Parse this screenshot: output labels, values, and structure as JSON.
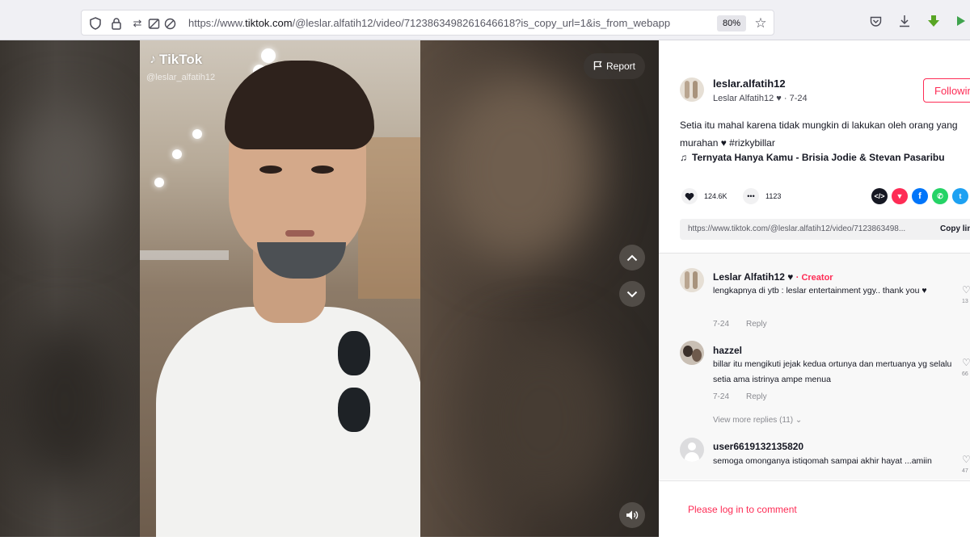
{
  "browser": {
    "url_prefix": "https://www.",
    "url_domain": "tiktok.com",
    "url_path": "/@leslar.alfatih12/video/7123863498261646618?is_copy_url=1&is_from_webapp",
    "zoom": "80%"
  },
  "video": {
    "logo_text": "TikTok",
    "watermark_user": "@leslar_alfatih12",
    "report_label": "Report"
  },
  "post": {
    "username": "leslar.alfatih12",
    "display_name": "Leslar Alfatih12 ♥",
    "date": "· 7-24",
    "follow_label": "Following",
    "caption_line1": "Setia itu mahal karena tidak mungkin di lakukan oleh orang yang",
    "caption_line2": "murahan ♥ #rizkybillar",
    "music": "Ternyata Hanya Kamu - Brisia Jodie & Stevan Pasaribu",
    "likes": "124.6K",
    "comments_count": "1123",
    "share_link": "https://www.tiktok.com/@leslar.alfatih12/video/7123863498...",
    "copy_link_label": "Copy link"
  },
  "comments": [
    {
      "name": "Leslar Alfatih12 ♥",
      "creator_label": "· Creator",
      "text": "lengkapnya di ytb : leslar entertainment ygy.. thank you ♥",
      "date": "7-24",
      "reply": "Reply",
      "likes": "13"
    },
    {
      "name": "hazzel",
      "text": "billar itu mengikuti jejak kedua ortunya dan mertuanya yg selalu setia ama istrinya ampe menua",
      "date": "7-24",
      "reply": "Reply",
      "likes": "66",
      "view_more": "View more replies (11) ⌄"
    },
    {
      "name": "user6619132135820",
      "text": "semoga omonganya istiqomah sampai akhir hayat ...amiin",
      "likes": "47"
    }
  ],
  "login_prompt": "Please log in to comment"
}
